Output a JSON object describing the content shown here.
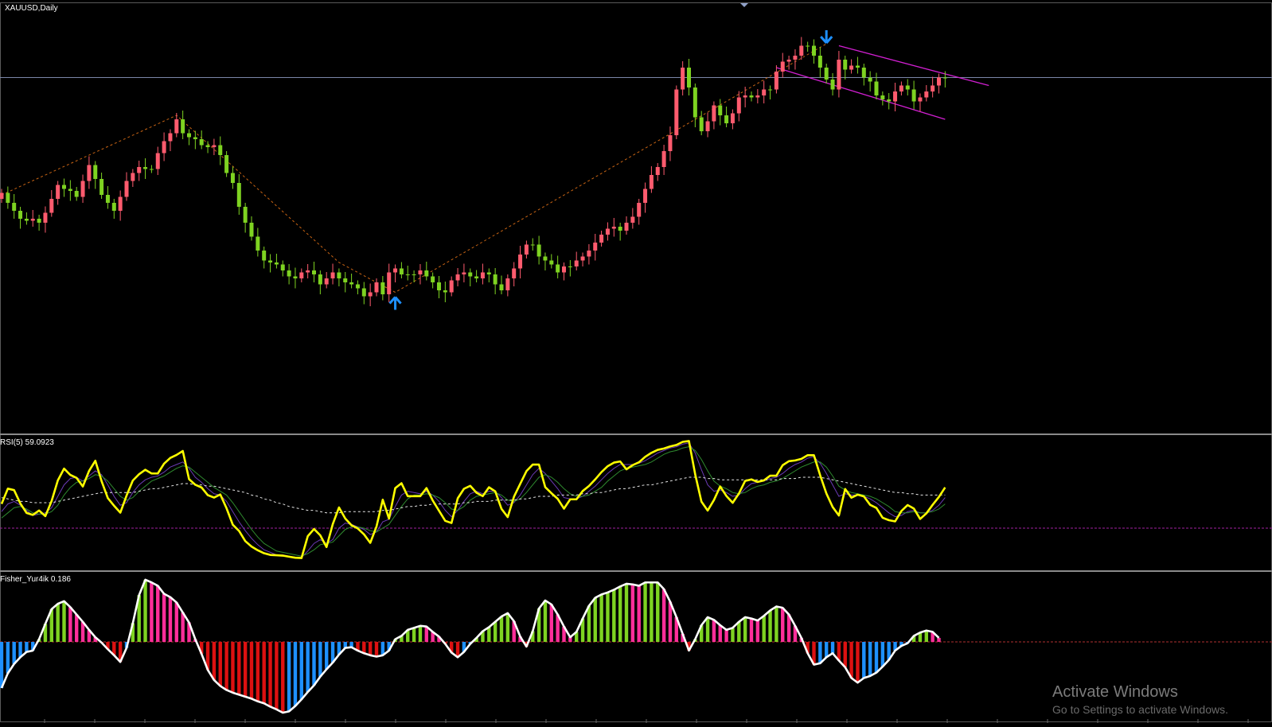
{
  "window": {
    "title": "XAUUSD,Daily"
  },
  "colors": {
    "bull": "#7ed321",
    "bear": "#ff5b6e",
    "arrow": "#1e90ff",
    "channel": "#d21fd2",
    "zigzag": "#c86414",
    "hline": "#7b86a8",
    "rsi": "#ffff00",
    "fisher_line": "#ffffff",
    "fisher_pos_up": "#7ed321",
    "fisher_pos_down": "#ff2e9a",
    "fisher_neg_down": "#dd1111",
    "fisher_neg_up": "#1e90ff"
  },
  "icons": [
    "arrow-up-icon",
    "arrow-down-icon"
  ],
  "rsi": {
    "label": "RSI(5) 59.0923"
  },
  "fisher": {
    "label": "Fisher_Yur4ik 0.186"
  },
  "watermark": {
    "line1": "Activate Windows",
    "line2": "Go to Settings to activate Windows."
  },
  "chart_data": [
    {
      "type": "candlestick",
      "title": "XAUUSD,Daily",
      "y_scale": "relative",
      "close": [
        58.0,
        59.5,
        57.0,
        55.0,
        53.0,
        52.5,
        53.0,
        52.0,
        54.5,
        58.0,
        61.5,
        60.5,
        60.0,
        58.5,
        62.5,
        66.5,
        63.0,
        59.0,
        57.0,
        55.0,
        58.5,
        62.5,
        64.5,
        66.0,
        65.5,
        65.5,
        69.5,
        72.5,
        74.5,
        78.0,
        74.5,
        73.5,
        73.0,
        71.5,
        71.0,
        71.5,
        69.0,
        64.5,
        62.0,
        56.0,
        52.0,
        48.5,
        45.0,
        42.5,
        42.0,
        41.5,
        40.0,
        38.5,
        38.0,
        39.5,
        40.0,
        39.0,
        36.5,
        38.0,
        39.5,
        38.0,
        37.0,
        36.5,
        35.5,
        33.5,
        34.5,
        37.0,
        34.0,
        39.5,
        40.5,
        39.0,
        39.0,
        39.0,
        40.0,
        38.5,
        37.0,
        35.0,
        34.5,
        37.5,
        39.0,
        39.5,
        38.5,
        38.0,
        39.5,
        39.0,
        36.5,
        35.0,
        38.0,
        40.5,
        44.0,
        46.5,
        46.5,
        43.5,
        42.5,
        41.5,
        39.5,
        41.0,
        41.0,
        42.5,
        43.5,
        45.0,
        47.0,
        49.0,
        50.5,
        51.0,
        50.0,
        52.0,
        53.5,
        57.0,
        60.5,
        64.0,
        66.0,
        70.0,
        74.0,
        85.5,
        91.0,
        86.0,
        78.5,
        75.0,
        77.5,
        81.5,
        79.0,
        77.0,
        79.5,
        83.5,
        84.0,
        83.5,
        84.0,
        85.5,
        85.5,
        90.0,
        92.5,
        93.0,
        94.0,
        96.5,
        96.5,
        94.0,
        91.0,
        88.0,
        85.5,
        93.0,
        90.5,
        91.5,
        91.0,
        88.5,
        87.5,
        84.0,
        83.0,
        82.5,
        85.0,
        86.5,
        85.5,
        82.5,
        83.5,
        85.0,
        86.5,
        88.5
      ],
      "open": [
        59.5,
        57.0,
        55.0,
        53.0,
        52.5,
        53.0,
        52.0,
        54.5,
        58.0,
        61.5,
        60.5,
        60.0,
        58.5,
        62.5,
        66.5,
        63.0,
        59.0,
        57.0,
        55.0,
        58.5,
        62.5,
        64.5,
        66.0,
        65.5,
        65.5,
        69.5,
        72.5,
        74.5,
        78.0,
        74.5,
        73.5,
        73.0,
        71.5,
        71.0,
        71.5,
        69.0,
        64.5,
        62.0,
        56.0,
        52.0,
        48.5,
        45.0,
        42.5,
        42.0,
        41.5,
        40.0,
        38.5,
        38.0,
        39.5,
        40.0,
        39.0,
        36.5,
        38.0,
        39.5,
        38.0,
        37.0,
        36.5,
        35.5,
        33.5,
        34.5,
        37.0,
        34.0,
        39.5,
        40.5,
        39.0,
        39.0,
        39.0,
        40.0,
        38.5,
        37.0,
        35.0,
        34.5,
        37.5,
        39.0,
        39.5,
        38.5,
        38.0,
        39.5,
        39.0,
        36.5,
        35.0,
        38.0,
        40.5,
        44.0,
        46.5,
        46.5,
        43.5,
        42.5,
        41.5,
        39.5,
        41.0,
        41.0,
        42.5,
        43.5,
        45.0,
        47.0,
        49.0,
        50.5,
        51.0,
        50.0,
        52.0,
        53.5,
        57.0,
        60.5,
        64.0,
        66.0,
        70.0,
        74.0,
        85.5,
        91.0,
        86.0,
        78.5,
        75.0,
        77.5,
        81.5,
        79.0,
        77.0,
        79.5,
        83.5,
        84.0,
        83.5,
        84.0,
        85.5,
        85.5,
        90.0,
        92.5,
        93.0,
        94.0,
        96.5,
        96.5,
        94.0,
        91.0,
        88.0,
        85.5,
        93.0,
        90.5,
        91.5,
        91.0,
        88.5,
        87.5,
        84.0,
        83.0,
        82.5,
        85.0,
        86.5,
        85.5,
        82.5,
        83.5,
        85.0,
        86.5,
        88.5,
        88.5
      ],
      "annotations": [
        {
          "type": "up-arrow",
          "bar": 63,
          "y": 31.5
        },
        {
          "type": "down-arrow",
          "bar": 132,
          "y": 99.0
        }
      ],
      "horizontal_line": 88.5,
      "zigzag": [
        [
          0,
          59.0
        ],
        [
          28,
          79.0
        ],
        [
          54,
          42.0
        ],
        [
          63,
          34.5
        ],
        [
          132,
          97.0
        ]
      ],
      "channel": {
        "upper": [
          [
            134,
            96.5
          ],
          [
            158,
            86.5
          ]
        ],
        "lower": [
          [
            124,
            91.0
          ],
          [
            151,
            78.0
          ]
        ]
      }
    },
    {
      "type": "line",
      "title": "RSI(5) 59.0923",
      "ylim": [
        0,
        100
      ],
      "levels": [
        30
      ],
      "series": [
        {
          "values": [
            49.07,
            61.05,
            59.89,
            49.4,
            41.95,
            40.4,
            43.86,
            39.47,
            51.26,
            67.48,
            76.78,
            71.81,
            69.47,
            62.75,
            74.98,
            82.96,
            66.95,
            53.64,
            47.61,
            42.16,
            55.59,
            67.42,
            72.36,
            75.88,
            72.97,
            72.97,
            80.66,
            85.2,
            87.54,
            90.61,
            68.48,
            64.07,
            61.95,
            55.93,
            54.03,
            56.48,
            45.63,
            32.72,
            27.82,
            19.81,
            15.57,
            12.6,
            10.3,
            8.96,
            8.7,
            8.42,
            7.58,
            6.77,
            6.51,
            23.69,
            29.35,
            24.38,
            15.15,
            33.18,
            46.27,
            37.6,
            32.26,
            29.75,
            25.12,
            18.45,
            31.27,
            52.34,
            37.49,
            61.45,
            65.3,
            55.11,
            55.11,
            55.11,
            61.48,
            51.72,
            43.7,
            35.74,
            34.03,
            53.43,
            60.93,
            63.27,
            57.79,
            55.15,
            62.1,
            58.91,
            45.18,
            38.72,
            54.7,
            64.79,
            74.82,
            79.95,
            79.95,
            62.25,
            57.43,
            53.03,
            45.33,
            52.66,
            52.66,
            59.18,
            63.1,
            68.32,
            74.01,
            78.7,
            81.52,
            82.42,
            76.24,
            79.53,
            81.74,
            86.06,
            89.2,
            91.53,
            92.56,
            94.2,
            95.37,
            97.81,
            98.46,
            72.32,
            50.85,
            43.84,
            52.08,
            62.78,
            55.26,
            49.92,
            57.24,
            67.12,
            68.29,
            66.31,
            67.53,
            71.23,
            71.23,
            79.45,
            82.6,
            83.2,
            84.43,
            87.32,
            87.32,
            71.57,
            57.24,
            46.61,
            39.93,
            60.76,
            53.94,
            56.3,
            54.93,
            48.31,
            45.89,
            38.18,
            36.26,
            35.31,
            43.49,
            48.15,
            45.4,
            37.23,
            41.61,
            48.32,
            54.51,
            61.98
          ]
        },
        {
          "values": [
            43,
            49,
            51,
            48,
            44,
            40,
            41,
            42,
            46,
            55,
            64,
            69,
            70,
            67,
            71,
            75,
            72,
            64,
            55,
            48,
            50,
            58,
            64,
            68,
            70,
            71,
            74,
            78,
            80,
            82,
            77,
            70,
            66,
            61,
            57,
            56,
            51,
            43,
            35,
            28,
            22,
            17,
            13,
            11,
            9,
            9,
            8,
            7,
            7,
            12,
            18,
            21,
            18,
            21,
            30,
            34,
            33,
            31,
            29,
            25,
            27,
            35,
            37,
            47,
            56,
            59,
            58,
            57,
            59,
            56,
            51,
            44,
            39,
            44,
            51,
            57,
            59,
            57,
            59,
            59,
            54,
            48,
            50,
            56,
            64,
            72,
            77,
            73,
            67,
            61,
            54,
            53,
            53,
            55,
            59,
            63,
            68,
            73,
            77,
            80,
            80,
            80,
            81,
            83,
            86,
            89,
            91,
            93,
            94,
            96,
            97,
            89,
            76,
            64,
            59,
            60,
            58,
            55,
            56,
            61,
            65,
            66,
            67,
            69,
            70,
            73,
            77,
            80,
            82,
            85,
            86,
            81,
            73,
            64,
            55,
            57,
            56,
            56,
            55,
            53,
            50,
            46,
            42,
            39,
            40,
            43,
            44,
            42,
            42,
            44,
            48,
            54
          ]
        },
        {
          "values": [
            38,
            42,
            46,
            47,
            45,
            42,
            41,
            41,
            43,
            48,
            56,
            62,
            66,
            67,
            69,
            72,
            71,
            67,
            61,
            55,
            52,
            54,
            59,
            63,
            67,
            69,
            71,
            74,
            77,
            79,
            78,
            74,
            70,
            66,
            62,
            59,
            56,
            50,
            43,
            36,
            29,
            23,
            18,
            15,
            12,
            11,
            10,
            9,
            8,
            10,
            13,
            17,
            18,
            19,
            24,
            29,
            31,
            31,
            30,
            28,
            27,
            30,
            33,
            40,
            47,
            53,
            56,
            56,
            57,
            56,
            54,
            50,
            45,
            44,
            47,
            52,
            55,
            56,
            57,
            58,
            56,
            52,
            51,
            53,
            58,
            64,
            70,
            72,
            70,
            66,
            61,
            57,
            55,
            55,
            56,
            59,
            62,
            67,
            71,
            75,
            77,
            78,
            79,
            80,
            82,
            85,
            88,
            90,
            91,
            93,
            94,
            91,
            84,
            75,
            67,
            63,
            61,
            58,
            57,
            58,
            61,
            63,
            64,
            66,
            67,
            69,
            72,
            75,
            78,
            80,
            82,
            82,
            78,
            71,
            63,
            60,
            58,
            57,
            56,
            55,
            53,
            50,
            47,
            43,
            42,
            42,
            43,
            42,
            42,
            43,
            45,
            49
          ]
        },
        {
          "values": [
            54,
            53,
            52,
            51,
            51,
            50,
            50,
            50,
            50,
            51,
            52,
            53,
            54,
            55,
            56,
            57,
            58,
            58,
            58,
            58,
            58,
            58,
            59,
            60,
            61,
            61,
            62,
            63,
            64,
            65,
            65,
            64,
            64,
            63,
            63,
            62,
            61,
            60,
            59,
            58,
            56,
            55,
            53,
            52,
            50,
            49,
            47,
            46,
            45,
            44,
            44,
            43,
            42,
            42,
            42,
            43,
            43,
            43,
            43,
            43,
            43,
            44,
            44,
            45,
            46,
            47,
            47,
            48,
            48,
            49,
            49,
            49,
            49,
            49,
            50,
            50,
            51,
            51,
            51,
            52,
            52,
            52,
            52,
            53,
            53,
            54,
            55,
            55,
            55,
            56,
            56,
            56,
            56,
            57,
            57,
            58,
            58,
            59,
            60,
            61,
            61,
            62,
            63,
            64,
            64,
            65,
            66,
            67,
            68,
            69,
            70,
            70,
            70,
            69,
            69,
            68,
            68,
            68,
            68,
            68,
            68,
            68,
            68,
            68,
            68,
            69,
            69,
            69,
            70,
            70,
            70,
            70,
            69,
            68,
            67,
            66,
            65,
            64,
            63,
            62,
            61,
            60,
            59,
            58,
            58,
            57,
            57,
            56,
            56,
            56,
            56,
            56
          ]
        }
      ]
    },
    {
      "type": "histogram+line",
      "title": "Fisher_Yur4ik 0.186",
      "ylim": [
        -1.0,
        1.0
      ],
      "zero_line": 0,
      "series": [
        {
          "values": [
            -0.69,
            -0.47,
            -0.33,
            -0.23,
            -0.15,
            -0.13,
            0.04,
            0.27,
            0.49,
            0.57,
            0.61,
            0.52,
            0.41,
            0.3,
            0.18,
            0.07,
            -0.01,
            -0.11,
            -0.2,
            -0.3,
            -0.09,
            0.28,
            0.7,
            0.93,
            0.89,
            0.84,
            0.72,
            0.67,
            0.59,
            0.44,
            0.29,
            0.04,
            -0.18,
            -0.42,
            -0.57,
            -0.66,
            -0.72,
            -0.76,
            -0.79,
            -0.82,
            -0.85,
            -0.89,
            -0.92,
            -0.97,
            -1.01,
            -1.06,
            -1.04,
            -0.96,
            -0.86,
            -0.75,
            -0.65,
            -0.52,
            -0.41,
            -0.31,
            -0.19,
            -0.09,
            -0.08,
            -0.13,
            -0.17,
            -0.2,
            -0.22,
            -0.2,
            -0.13,
            0.04,
            0.09,
            0.18,
            0.21,
            0.24,
            0.23,
            0.15,
            0.08,
            -0.03,
            -0.16,
            -0.23,
            -0.15,
            -0.03,
            0.06,
            0.16,
            0.22,
            0.3,
            0.38,
            0.43,
            0.31,
            0.08,
            -0.07,
            0.16,
            0.5,
            0.62,
            0.56,
            0.41,
            0.23,
            0.07,
            0.15,
            0.35,
            0.54,
            0.66,
            0.71,
            0.74,
            0.78,
            0.83,
            0.87,
            0.86,
            0.84,
            0.89,
            0.89,
            0.89,
            0.79,
            0.6,
            0.37,
            0.12,
            -0.13,
            0.04,
            0.25,
            0.37,
            0.33,
            0.25,
            0.18,
            0.21,
            0.3,
            0.37,
            0.35,
            0.32,
            0.39,
            0.47,
            0.53,
            0.51,
            0.41,
            0.24,
            0.06,
            -0.17,
            -0.34,
            -0.32,
            -0.23,
            -0.17,
            -0.28,
            -0.38,
            -0.54,
            -0.61,
            -0.54,
            -0.51,
            -0.46,
            -0.37,
            -0.27,
            -0.13,
            -0.06,
            -0.02,
            0.09,
            0.14,
            0.17,
            0.15,
            0.06
          ]
        }
      ]
    }
  ]
}
